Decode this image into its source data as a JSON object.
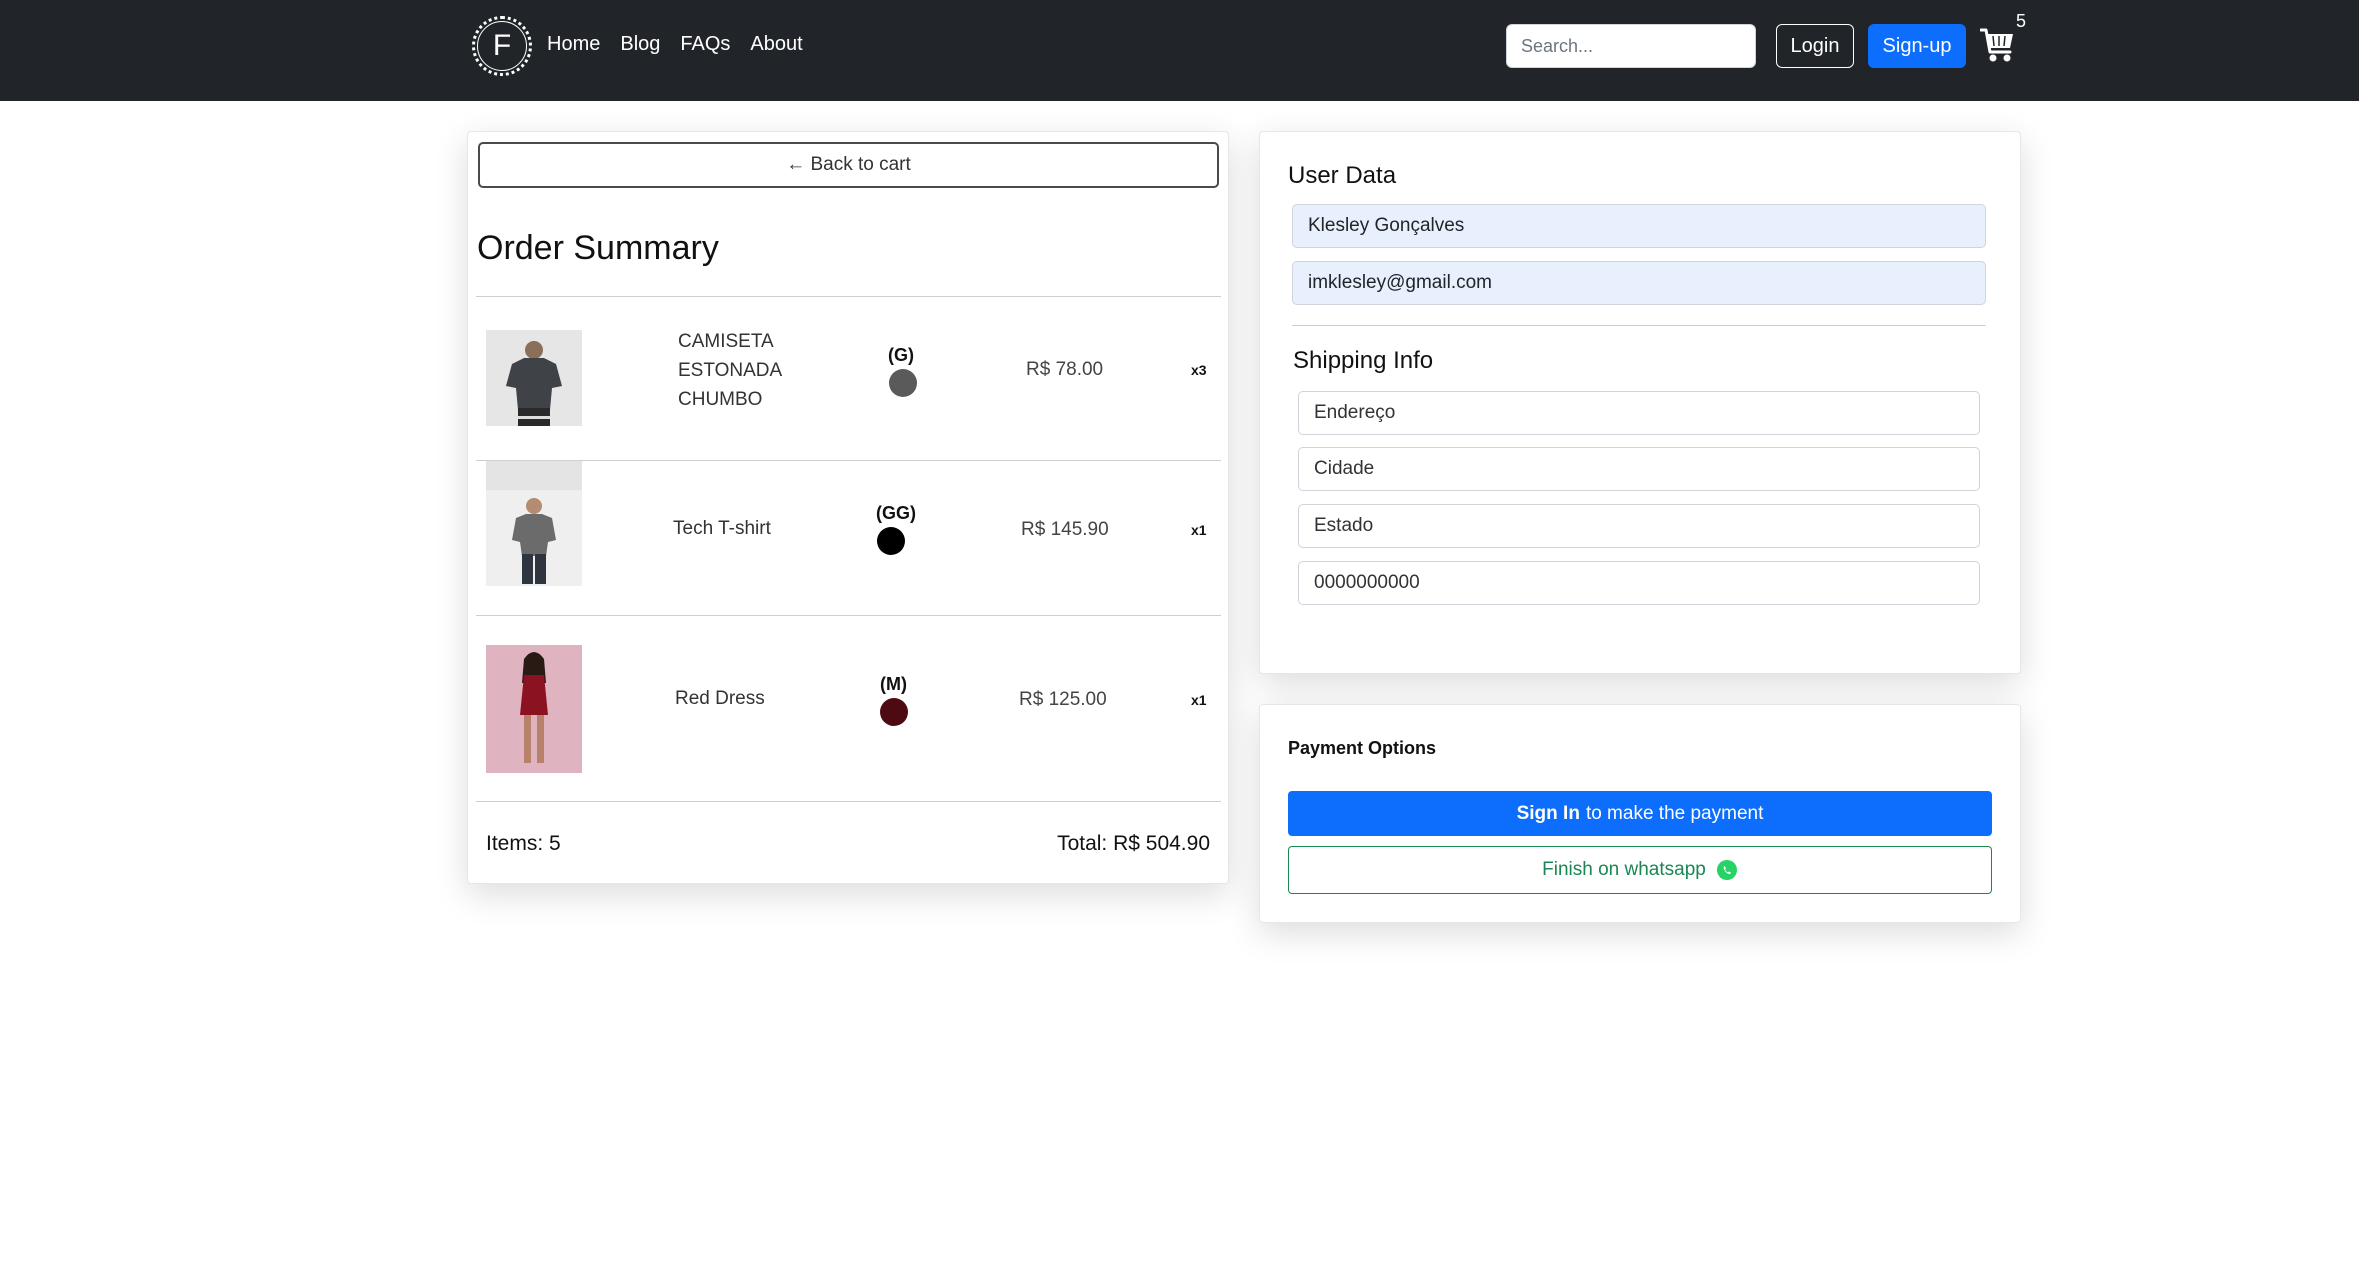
{
  "navbar": {
    "logo_letter": "F",
    "links": [
      {
        "label": "Home"
      },
      {
        "label": "Blog"
      },
      {
        "label": "FAQs"
      },
      {
        "label": "About"
      }
    ],
    "search_placeholder": "Search...",
    "login_label": "Login",
    "signup_label": "Sign-up",
    "cart_count": "5"
  },
  "order": {
    "back_label": "← Back to cart",
    "title": "Order Summary",
    "items": [
      {
        "name": "CAMISETA ESTONADA CHUMBO",
        "size": "(G)",
        "color": "#5a5a5a",
        "price": "R$ 78.00",
        "qty": "x3"
      },
      {
        "name": "Tech T-shirt",
        "size": "(GG)",
        "color": "#000000",
        "price": "R$ 145.90",
        "qty": "x1"
      },
      {
        "name": "Red Dress",
        "size": "(M)",
        "color": "#4d0a12",
        "price": "R$ 125.00",
        "qty": "x1"
      }
    ],
    "items_count": "Items: 5",
    "total": "Total: R$ 504.90"
  },
  "user": {
    "title": "User Data",
    "name_value": "Klesley Gonçalves",
    "email_value": "imklesley@gmail.com"
  },
  "shipping": {
    "title": "Shipping Info",
    "address_placeholder": "Endereço",
    "city_placeholder": "Cidade",
    "state_placeholder": "Estado",
    "phone_placeholder": "0000000000"
  },
  "payment": {
    "title": "Payment Options",
    "signin_bold": "Sign In",
    "signin_rest": "to make the payment",
    "whatsapp_label": "Finish on whatsapp"
  },
  "colors": {
    "navbar": "#212529",
    "primary": "#0d6efd",
    "success": "#198754",
    "autofill": "#e8f0fe"
  }
}
